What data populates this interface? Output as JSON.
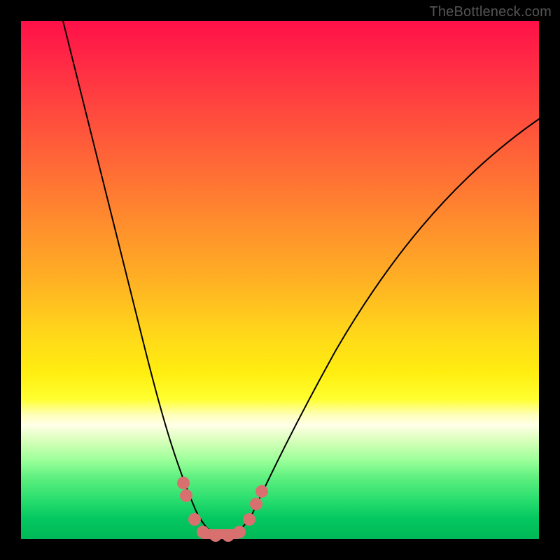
{
  "watermark": "TheBottleneck.com",
  "colors": {
    "background": "#000000",
    "curve": "#000000",
    "marker": "#d87070"
  },
  "chart_data": {
    "type": "line",
    "title": "",
    "xlabel": "",
    "ylabel": "",
    "xlim": [
      0,
      100
    ],
    "ylim": [
      0,
      100
    ],
    "grid": false,
    "note": "V-shaped bottleneck curve on rainbow gradient; minimum ~0 around x≈35–40; y rises steeply toward both sides. Salmon markers near the valley.",
    "series": [
      {
        "name": "bottleneck-curve",
        "x": [
          0,
          5,
          10,
          15,
          20,
          25,
          28,
          30,
          32,
          34,
          36,
          38,
          40,
          42,
          45,
          50,
          55,
          60,
          65,
          70,
          75,
          80,
          85,
          90,
          95,
          100
        ],
        "y": [
          100,
          85,
          70,
          55,
          40,
          25,
          16,
          10,
          5,
          2,
          0,
          0,
          0,
          2,
          5,
          12,
          20,
          28,
          35,
          42,
          48,
          54,
          60,
          65,
          70,
          75
        ]
      }
    ],
    "markers": [
      {
        "x": 30,
        "y": 12
      },
      {
        "x": 31,
        "y": 9
      },
      {
        "x": 33,
        "y": 3
      },
      {
        "x": 35,
        "y": 0
      },
      {
        "x": 37,
        "y": 0
      },
      {
        "x": 39,
        "y": 0
      },
      {
        "x": 41,
        "y": 0
      },
      {
        "x": 43,
        "y": 3
      },
      {
        "x": 44,
        "y": 6
      },
      {
        "x": 46,
        "y": 10
      }
    ]
  }
}
